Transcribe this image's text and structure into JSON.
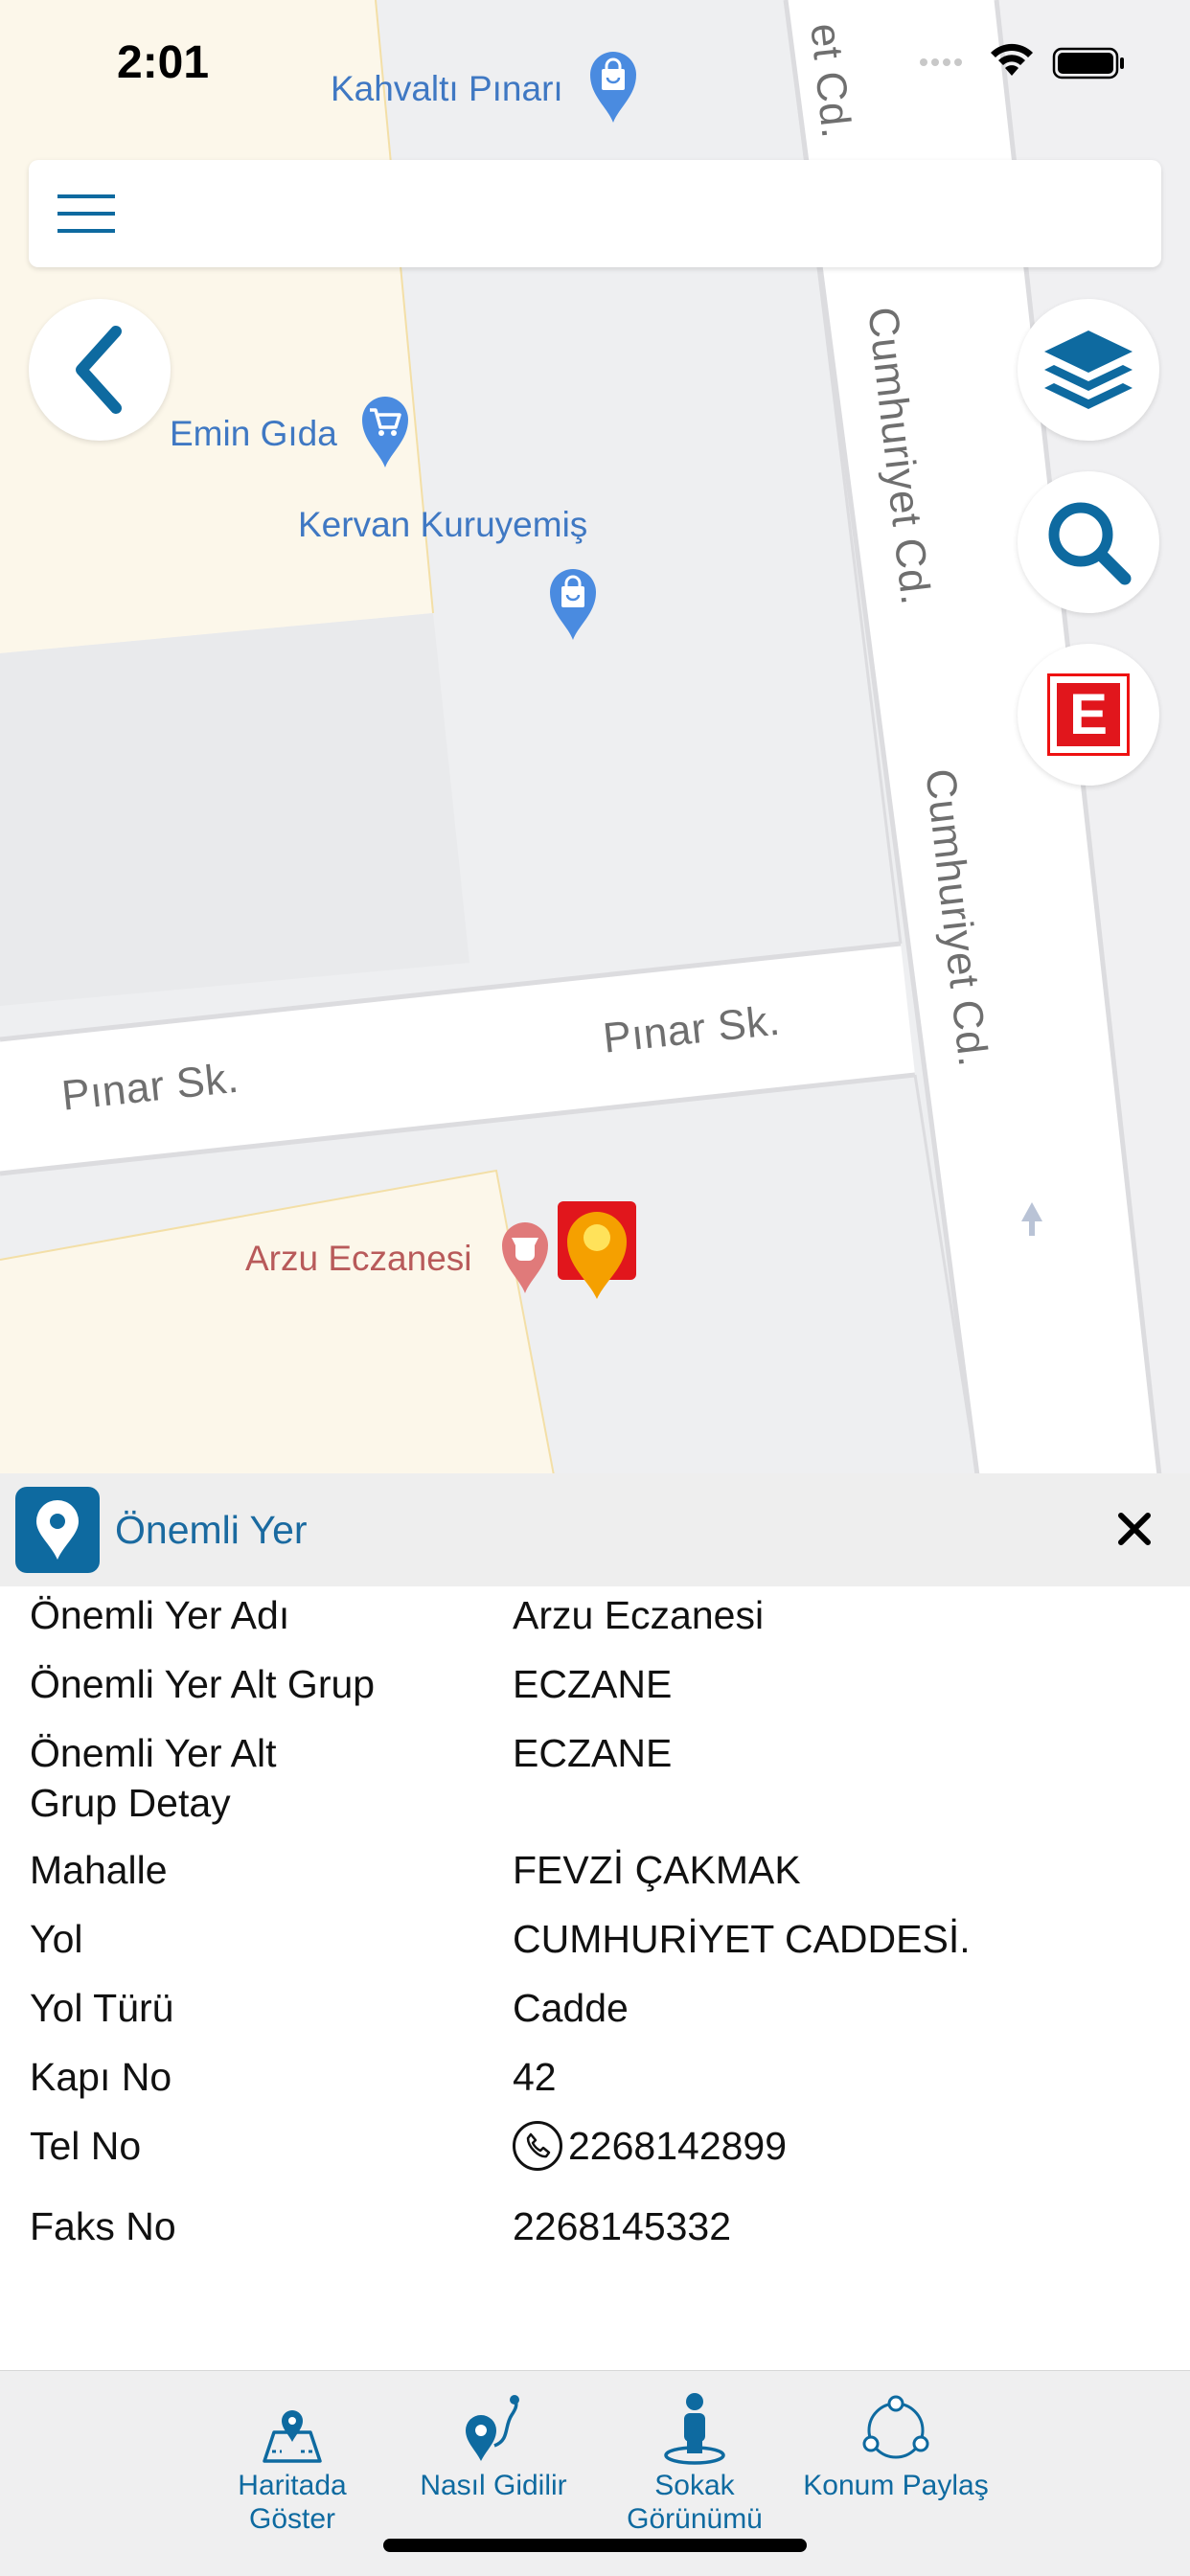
{
  "status_bar": {
    "time": "2:01"
  },
  "map": {
    "pois": [
      {
        "name": "Kahvaltı Pınarı",
        "icon": "shopping-bag-icon"
      },
      {
        "name": "Emin Gıda",
        "icon": "shopping-cart-icon"
      },
      {
        "name": "Kervan Kuruyemiş",
        "icon": "shopping-bag-icon"
      },
      {
        "name": "Arzu Eczanesi",
        "icon": "pharmacy-icon"
      }
    ],
    "streets": [
      "et Cd.",
      "Cumhuriyet Cd.",
      "Cumhuriyet Cd.",
      "Pınar Sk.",
      "Pınar Sk."
    ],
    "e_badge": "E",
    "colors": {
      "accent": "#0e6aa0",
      "pin": "#f5a000",
      "poi_blue": "#4a8be0",
      "poi_red": "#e07a7a"
    }
  },
  "panel": {
    "title": "Önemli Yer",
    "rows": [
      {
        "label": "Önemli Yer Adı",
        "value": "Arzu Eczanesi"
      },
      {
        "label": "Önemli Yer Alt Grup",
        "value": "ECZANE"
      },
      {
        "label": "Önemli Yer Alt Grup Detay",
        "value": "ECZANE"
      },
      {
        "label": "Mahalle",
        "value": "FEVZİ ÇAKMAK"
      },
      {
        "label": "Yol",
        "value": "CUMHURİYET CADDESİ."
      },
      {
        "label": "Yol Türü",
        "value": "Cadde"
      },
      {
        "label": "Kapı No",
        "value": "42"
      },
      {
        "label": "Tel No",
        "value": "2268142899"
      },
      {
        "label": "Faks No",
        "value": "2268145332"
      }
    ]
  },
  "tabbar": {
    "tabs": [
      {
        "label": "Haritada Göster",
        "icon": "map-pin-icon"
      },
      {
        "label": "Nasıl Gidilir",
        "icon": "route-icon"
      },
      {
        "label": "Sokak Görünümü",
        "icon": "street-view-icon"
      },
      {
        "label": "Konum Paylaş",
        "icon": "share-location-icon"
      }
    ]
  }
}
